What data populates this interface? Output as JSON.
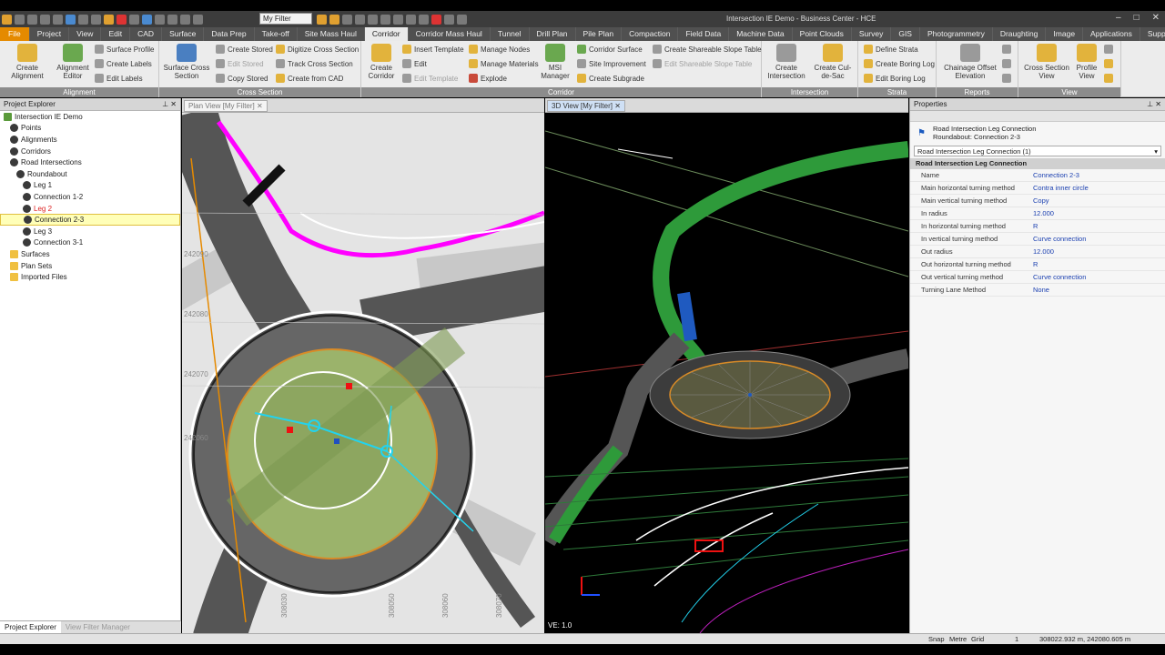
{
  "window": {
    "title": "Intersection IE Demo - Business Center - HCE",
    "filter": "My Filter"
  },
  "ribbon_tabs": [
    "File",
    "Project",
    "View",
    "Edit",
    "CAD",
    "Surface",
    "Data Prep",
    "Take-off",
    "Site Mass Haul",
    "Corridor",
    "Corridor Mass Haul",
    "Tunnel",
    "Drill Plan",
    "Pile Plan",
    "Compaction",
    "Field Data",
    "Machine Data",
    "Point Clouds",
    "Survey",
    "GIS",
    "Photogrammetry",
    "Draughting",
    "Image",
    "Applications",
    "Support"
  ],
  "groups": {
    "alignment": {
      "name": "Alignment",
      "create_alignment": "Create Alignment",
      "alignment_editor": "Alignment Editor",
      "surface_profile": "Surface Profile",
      "create_labels": "Create Labels",
      "edit_labels": "Edit Labels"
    },
    "cross_section": {
      "name": "Cross Section",
      "surface_cross_section": "Surface Cross Section",
      "create_stored": "Create Stored",
      "edit_stored": "Edit Stored",
      "copy_stored": "Copy Stored",
      "digitize": "Digitize Cross Section",
      "track": "Track Cross Section",
      "from_cad": "Create from CAD"
    },
    "corridor": {
      "name": "Corridor",
      "create_corridor": "Create Corridor",
      "insert_template": "Insert Template",
      "edit": "Edit",
      "edit_template": "Edit Template",
      "manage_nodes": "Manage Nodes",
      "manage_materials": "Manage Materials",
      "explode": "Explode",
      "msi_manager": "MSI Manager",
      "corridor_surface": "Corridor Surface",
      "site_improvement": "Site Improvement",
      "create_subgrade": "Create Subgrade",
      "create_shareable": "Create Shareable Slope Table",
      "edit_shareable": "Edit Shareable Slope Table"
    },
    "intersection": {
      "name": "Intersection",
      "create_intersection": "Create Intersection",
      "create_cul": "Create Cul-de-Sac"
    },
    "strata": {
      "name": "Strata",
      "define_strata": "Define Strata",
      "create_boring": "Create Boring Log",
      "edit_boring": "Edit Boring Log"
    },
    "reports": {
      "name": "Reports",
      "chainage": "Chainage Offset Elevation"
    },
    "view": {
      "name": "View",
      "cross_section_view": "Cross Section View",
      "profile_view": "Profile View"
    }
  },
  "explorer": {
    "title": "Project Explorer",
    "items": [
      {
        "label": "Intersection IE Demo",
        "indent": 0,
        "icon": "project-icon"
      },
      {
        "label": "Points",
        "indent": 1,
        "icon": "points-icon"
      },
      {
        "label": "Alignments",
        "indent": 1,
        "icon": "alignments-icon"
      },
      {
        "label": "Corridors",
        "indent": 1,
        "icon": "corridors-icon"
      },
      {
        "label": "Road Intersections",
        "indent": 1,
        "icon": "intersection-icon"
      },
      {
        "label": "Roundabout",
        "indent": 2,
        "icon": "roundabout-icon"
      },
      {
        "label": "Leg 1",
        "indent": 3,
        "icon": "leg-icon"
      },
      {
        "label": "Connection 1-2",
        "indent": 3,
        "icon": "connection-icon"
      },
      {
        "label": "Leg 2",
        "indent": 3,
        "icon": "leg-icon",
        "state": "red"
      },
      {
        "label": "Connection 2-3",
        "indent": 3,
        "icon": "connection-icon",
        "state": "selected"
      },
      {
        "label": "Leg 3",
        "indent": 3,
        "icon": "leg-icon"
      },
      {
        "label": "Connection 3-1",
        "indent": 3,
        "icon": "connection-icon"
      },
      {
        "label": "Surfaces",
        "indent": 1,
        "icon": "folder-icon"
      },
      {
        "label": "Plan Sets",
        "indent": 1,
        "icon": "folder-icon"
      },
      {
        "label": "Imported Files",
        "indent": 1,
        "icon": "folder-icon"
      }
    ],
    "bottom_tabs": [
      "Project Explorer",
      "View Filter Manager"
    ]
  },
  "plan_view": {
    "tab": "Plan View [My Filter]",
    "labels": [
      "242090",
      "242080",
      "242070",
      "242060",
      "308030",
      "308050",
      "308060",
      "308070"
    ]
  },
  "view3d": {
    "tab": "3D View [My Filter]",
    "ve": "VE: 1.0"
  },
  "properties": {
    "title": "Properties",
    "object_type": "Road Intersection Leg Connection",
    "object_name": "Roundabout: Connection 2-3",
    "selector": "Road Intersection Leg Connection (1)",
    "section": "Road Intersection Leg Connection",
    "rows": [
      {
        "k": "Name",
        "v": "Connection 2-3"
      },
      {
        "k": "Main horizontal turning method",
        "v": "Contra inner circle"
      },
      {
        "k": "Main vertical turning method",
        "v": "Copy"
      },
      {
        "k": "In radius",
        "v": "12.000"
      },
      {
        "k": "In horizontal turning method",
        "v": "R"
      },
      {
        "k": "In vertical turning method",
        "v": "Curve connection"
      },
      {
        "k": "Out radius",
        "v": "12.000"
      },
      {
        "k": "Out horizontal turning method",
        "v": "R"
      },
      {
        "k": "Out vertical turning method",
        "v": "Curve connection"
      },
      {
        "k": "Turning Lane Method",
        "v": "None"
      }
    ]
  },
  "status": {
    "snap": "Snap",
    "units": "Metre",
    "grid": "Grid",
    "count": "1",
    "coords": "308022.932 m, 242080.605 m"
  }
}
